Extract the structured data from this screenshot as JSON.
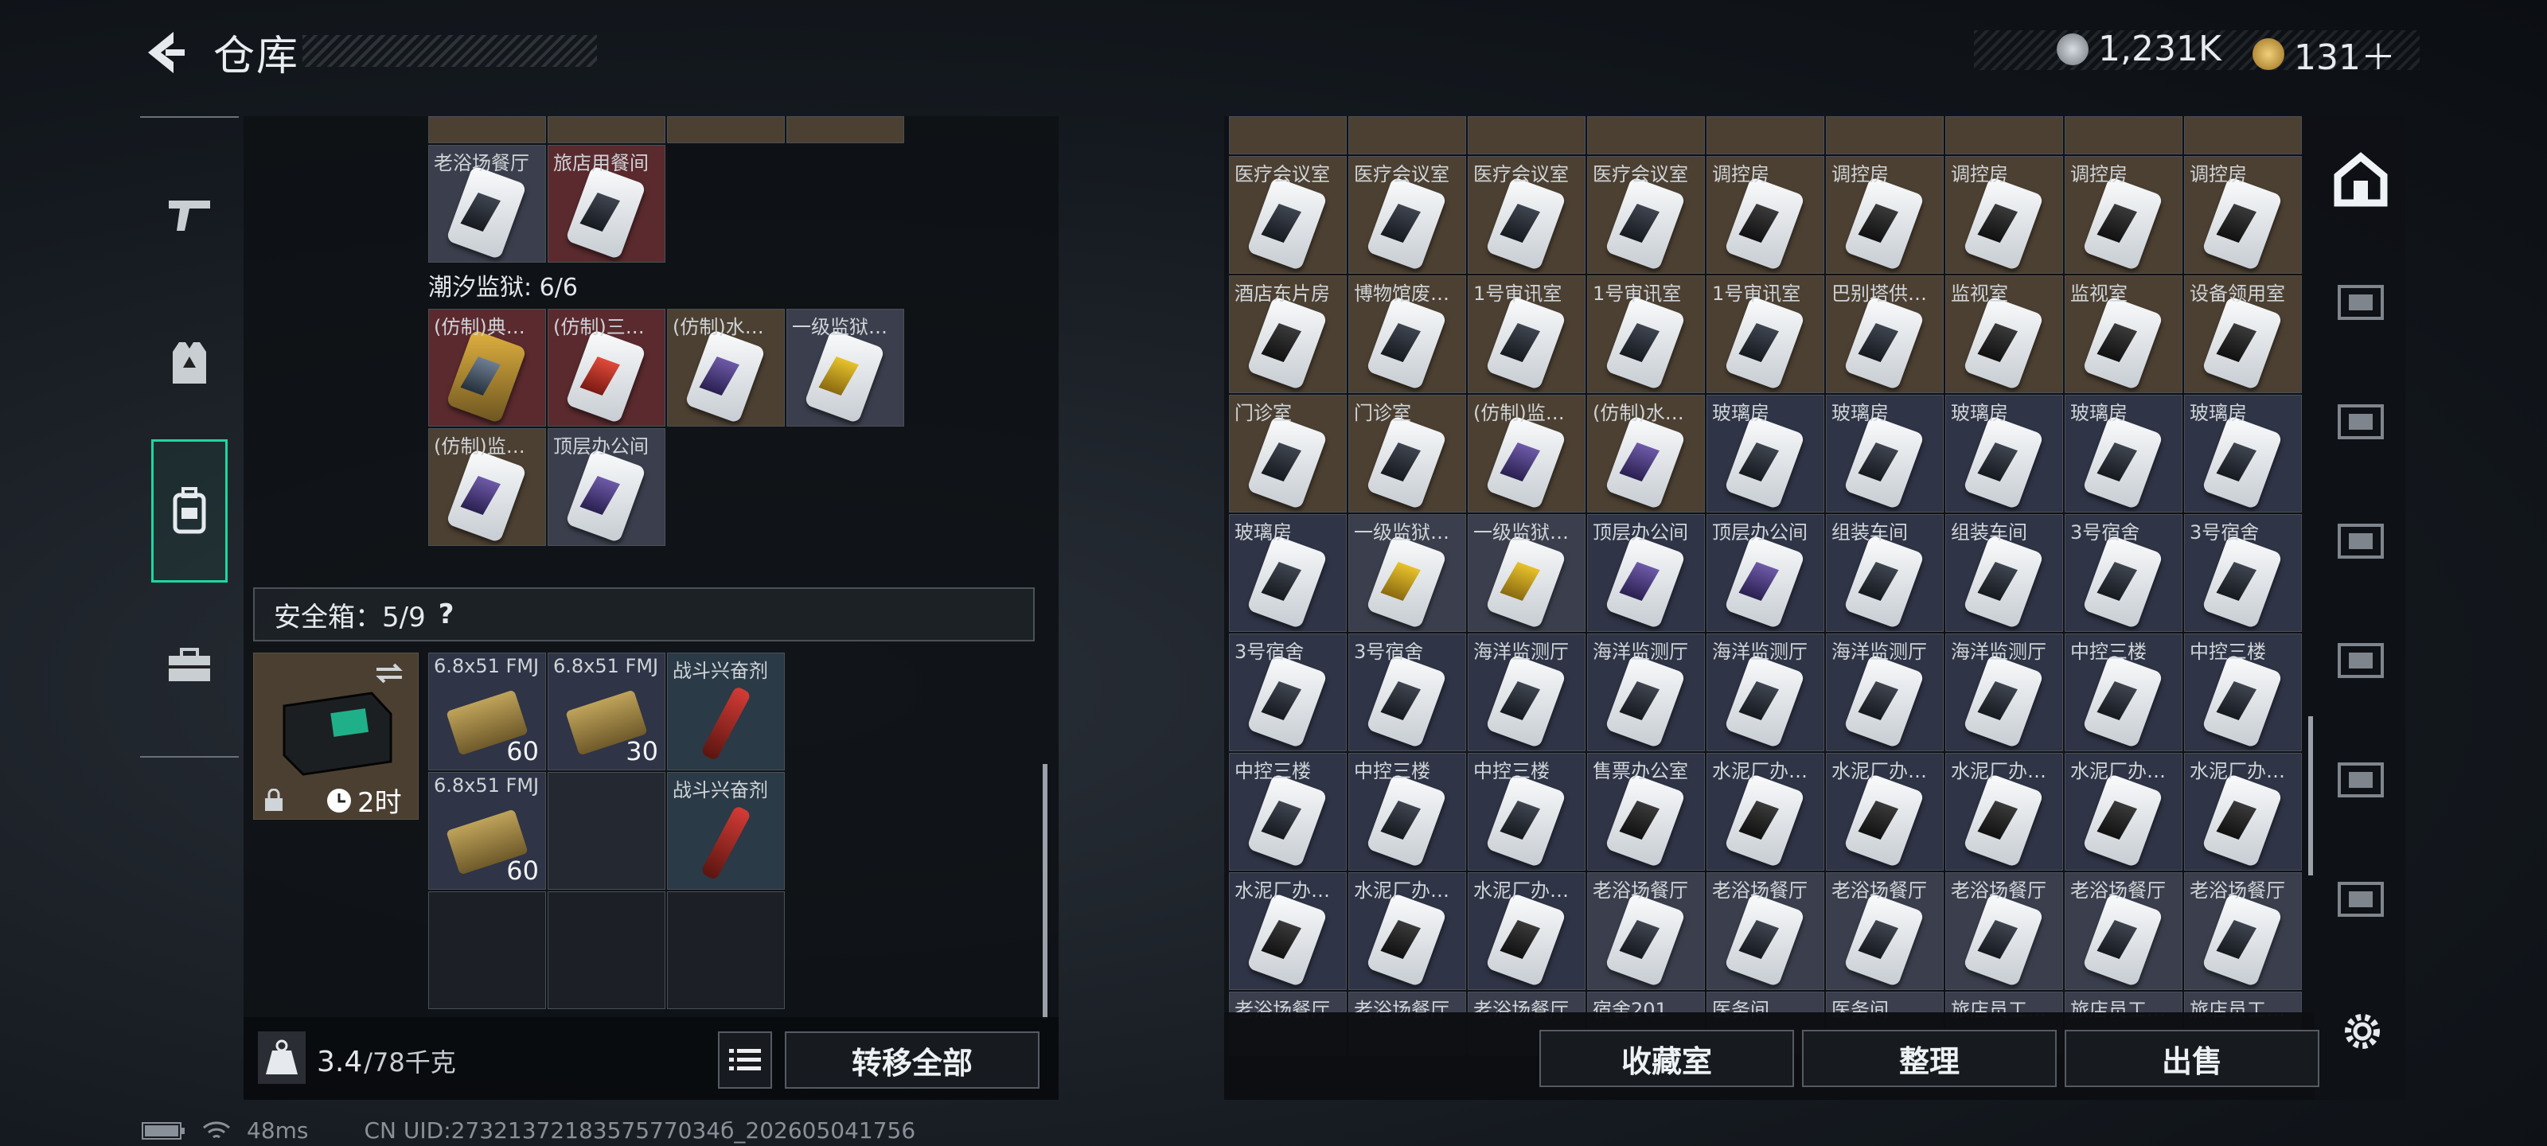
{
  "header": {
    "title": "仓库",
    "currency": [
      {
        "icon": "silver-coin-icon",
        "value": "1,231K"
      },
      {
        "icon": "gold-coin-icon",
        "value": "131＋"
      }
    ]
  },
  "left_tabs": [
    {
      "name": "weapon-tab",
      "icon": "pistol-icon"
    },
    {
      "name": "armor-tab",
      "icon": "armor-vest-icon"
    },
    {
      "name": "backpack-tab",
      "icon": "backpack-icon",
      "active": true
    },
    {
      "name": "case-tab",
      "icon": "briefcase-icon"
    }
  ],
  "left_panel": {
    "top_items": [
      {
        "label": "老浴场餐厅",
        "bg": "gray",
        "card": "photo"
      },
      {
        "label": "旅店用餐间",
        "bg": "red",
        "card": "photo"
      }
    ],
    "prison_label": "潮汐监狱: 6/6",
    "prison_items": [
      {
        "label": "(仿制)典…",
        "bg": "red",
        "card": "gold"
      },
      {
        "label": "(仿制)三…",
        "bg": "red",
        "card": "red"
      },
      {
        "label": "(仿制)水…",
        "bg": "brown",
        "card": "purple"
      },
      {
        "label": "一级监狱…",
        "bg": "gray",
        "card": "yellow"
      },
      {
        "label": "(仿制)监…",
        "bg": "brown",
        "card": "purple"
      },
      {
        "label": "顶层办公间",
        "bg": "gray",
        "card": "purple"
      }
    ],
    "safe_label": "安全箱：5/9",
    "safe_help": "?",
    "safe_timer": "2时",
    "safe_items": [
      {
        "label": "6.8x51 FMJ",
        "type": "ammo",
        "count": "60",
        "bg": "navy"
      },
      {
        "label": "6.8x51 FMJ",
        "type": "ammo",
        "count": "30",
        "bg": "navy"
      },
      {
        "label": "战斗兴奋剂",
        "type": "syringe",
        "count": "",
        "bg": "blue"
      },
      {
        "label": "6.8x51 FMJ",
        "type": "ammo",
        "count": "60",
        "bg": "navy"
      },
      {
        "label": "",
        "type": "empty",
        "count": "",
        "bg": "dark"
      },
      {
        "label": "战斗兴奋剂",
        "type": "syringe",
        "count": "",
        "bg": "blue"
      }
    ],
    "weight_value": "3.4",
    "weight_max": "/78千克",
    "transfer_all": "转移全部"
  },
  "right_panel": {
    "rows": [
      [
        {
          "l": "医疗会议室",
          "b": "brown"
        },
        {
          "l": "医疗会议室",
          "b": "brown"
        },
        {
          "l": "医疗会议室",
          "b": "brown"
        },
        {
          "l": "医疗会议室",
          "b": "brown"
        },
        {
          "l": "调控房",
          "b": "brown",
          "c": "dark"
        },
        {
          "l": "调控房",
          "b": "brown",
          "c": "dark"
        },
        {
          "l": "调控房",
          "b": "brown",
          "c": "dark"
        },
        {
          "l": "调控房",
          "b": "brown",
          "c": "dark"
        },
        {
          "l": "调控房",
          "b": "brown",
          "c": "dark"
        }
      ],
      [
        {
          "l": "酒店东片房",
          "b": "brown",
          "c": "dark"
        },
        {
          "l": "博物馆废…",
          "b": "brown"
        },
        {
          "l": "1号审讯室",
          "b": "brown"
        },
        {
          "l": "1号审讯室",
          "b": "brown"
        },
        {
          "l": "1号审讯室",
          "b": "brown"
        },
        {
          "l": "巴别塔供…",
          "b": "brown"
        },
        {
          "l": "监视室",
          "b": "brown",
          "c": "dark"
        },
        {
          "l": "监视室",
          "b": "brown",
          "c": "dark"
        },
        {
          "l": "设备领用室",
          "b": "brown",
          "c": "dark"
        }
      ],
      [
        {
          "l": "门诊室",
          "b": "brown"
        },
        {
          "l": "门诊室",
          "b": "brown"
        },
        {
          "l": "(仿制)监…",
          "b": "brown",
          "c": "purple"
        },
        {
          "l": "(仿制)水…",
          "b": "brown",
          "c": "purple"
        },
        {
          "l": "玻璃房",
          "b": "navy"
        },
        {
          "l": "玻璃房",
          "b": "navy"
        },
        {
          "l": "玻璃房",
          "b": "navy"
        },
        {
          "l": "玻璃房",
          "b": "navy"
        },
        {
          "l": "玻璃房",
          "b": "navy"
        }
      ],
      [
        {
          "l": "玻璃房",
          "b": "navy"
        },
        {
          "l": "一级监狱…",
          "b": "gray",
          "c": "yellow"
        },
        {
          "l": "一级监狱…",
          "b": "gray",
          "c": "yellow"
        },
        {
          "l": "顶层办公间",
          "b": "navy",
          "c": "purple"
        },
        {
          "l": "顶层办公间",
          "b": "navy",
          "c": "purple"
        },
        {
          "l": "组装车间",
          "b": "navy"
        },
        {
          "l": "组装车间",
          "b": "navy"
        },
        {
          "l": "3号宿舍",
          "b": "navy"
        },
        {
          "l": "3号宿舍",
          "b": "navy"
        }
      ],
      [
        {
          "l": "3号宿舍",
          "b": "navy"
        },
        {
          "l": "3号宿舍",
          "b": "navy"
        },
        {
          "l": "海洋监测厅",
          "b": "navy"
        },
        {
          "l": "海洋监测厅",
          "b": "navy"
        },
        {
          "l": "海洋监测厅",
          "b": "navy"
        },
        {
          "l": "海洋监测厅",
          "b": "navy"
        },
        {
          "l": "海洋监测厅",
          "b": "navy"
        },
        {
          "l": "中控三楼",
          "b": "navy"
        },
        {
          "l": "中控三楼",
          "b": "navy"
        }
      ],
      [
        {
          "l": "中控三楼",
          "b": "navy"
        },
        {
          "l": "中控三楼",
          "b": "navy"
        },
        {
          "l": "中控三楼",
          "b": "navy"
        },
        {
          "l": "售票办公室",
          "b": "navy",
          "c": "dark"
        },
        {
          "l": "水泥厂办…",
          "b": "navy",
          "c": "dark"
        },
        {
          "l": "水泥厂办…",
          "b": "navy",
          "c": "dark"
        },
        {
          "l": "水泥厂办…",
          "b": "navy",
          "c": "dark"
        },
        {
          "l": "水泥厂办…",
          "b": "navy",
          "c": "dark"
        },
        {
          "l": "水泥厂办…",
          "b": "navy",
          "c": "dark"
        }
      ],
      [
        {
          "l": "水泥厂办…",
          "b": "navy",
          "c": "dark"
        },
        {
          "l": "水泥厂办…",
          "b": "navy",
          "c": "dark"
        },
        {
          "l": "水泥厂办…",
          "b": "navy",
          "c": "dark"
        },
        {
          "l": "老浴场餐厅",
          "b": "gray",
          "c": "photo"
        },
        {
          "l": "老浴场餐厅",
          "b": "gray",
          "c": "photo"
        },
        {
          "l": "老浴场餐厅",
          "b": "gray",
          "c": "photo"
        },
        {
          "l": "老浴场餐厅",
          "b": "gray",
          "c": "photo"
        },
        {
          "l": "老浴场餐厅",
          "b": "gray",
          "c": "photo"
        },
        {
          "l": "老浴场餐厅",
          "b": "gray",
          "c": "photo"
        }
      ],
      [
        {
          "l": "老浴场餐厅",
          "b": "gray"
        },
        {
          "l": "老浴场餐厅",
          "b": "gray"
        },
        {
          "l": "老浴场餐厅",
          "b": "gray"
        },
        {
          "l": "宿舍201",
          "b": "gray"
        },
        {
          "l": "医务间",
          "b": "gray"
        },
        {
          "l": "医务间",
          "b": "gray"
        },
        {
          "l": "旅店员工…",
          "b": "gray"
        },
        {
          "l": "旅店员工…",
          "b": "gray"
        },
        {
          "l": "旅店员工…",
          "b": "gray"
        }
      ]
    ],
    "buttons": {
      "collection": "收藏室",
      "sort": "整理",
      "sell": "出售"
    }
  },
  "right_tabs": [
    "safehouse-icon",
    "card-folder-iv-icon",
    "card-folder-v-icon",
    "card-folder-iii-icon",
    "card-folder-iii-b-icon",
    "card-folder-iv-b-icon",
    "card-folder-iv-c-icon"
  ],
  "status": {
    "ping": "48ms",
    "uid": "CN UID:2732137218357577034б_202605041756"
  },
  "colors": {
    "accent": "#1fd6a0"
  }
}
